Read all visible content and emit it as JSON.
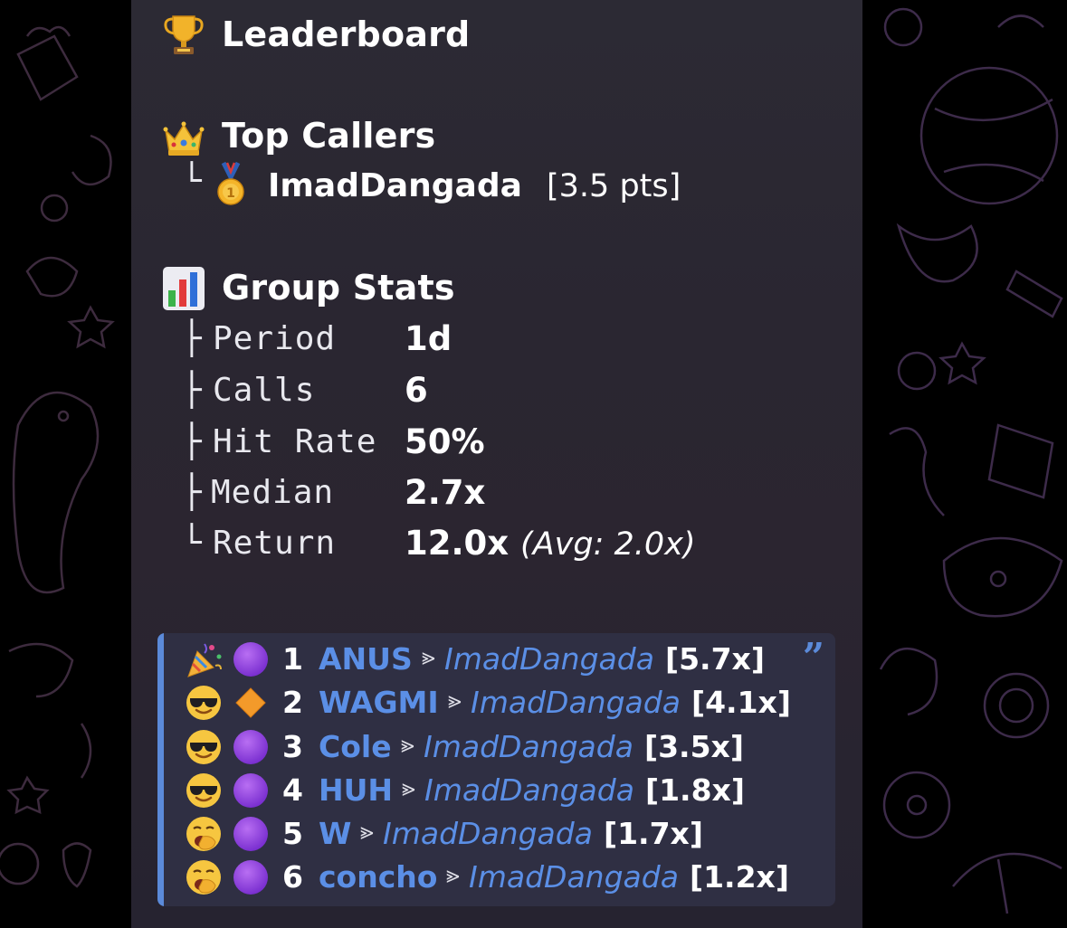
{
  "header": {
    "title": "Leaderboard",
    "title_icon": "trophy-icon"
  },
  "top_callers": {
    "heading": "Top Callers",
    "heading_icon": "crown-icon",
    "branch": "└",
    "entries": [
      {
        "medal_icon": "gold-medal-icon",
        "name": "ImadDangada",
        "points": "[3.5 pts]"
      }
    ]
  },
  "group_stats": {
    "heading": "Group Stats",
    "heading_icon": "bar-chart-icon",
    "rows": [
      {
        "branch": "├",
        "label": "Period",
        "value": "1d"
      },
      {
        "branch": "├",
        "label": "Calls",
        "value": "6"
      },
      {
        "branch": "├",
        "label": "Hit Rate",
        "value": "50%"
      },
      {
        "branch": "├",
        "label": "Median",
        "value": "2.7x"
      },
      {
        "branch": "└",
        "label": "Return",
        "value": "12.0x",
        "note": "(Avg: 2.0x)"
      }
    ]
  },
  "calls": {
    "quote_icon": "quote-icon",
    "separator": "⪢",
    "rows": [
      {
        "icon1": "party-popper-icon",
        "icon2": "purple-circle-icon",
        "rank": "1",
        "ticker": "ANUS",
        "caller": "ImadDangada",
        "multiple": "[5.7x]"
      },
      {
        "icon1": "sunglasses-face-icon",
        "icon2": "orange-diamond-icon",
        "rank": "2",
        "ticker": "WAGMI",
        "caller": "ImadDangada",
        "multiple": "[4.1x]"
      },
      {
        "icon1": "sunglasses-face-icon",
        "icon2": "purple-circle-icon",
        "rank": "3",
        "ticker": "Cole",
        "caller": "ImadDangada",
        "multiple": "[3.5x]"
      },
      {
        "icon1": "sunglasses-face-icon",
        "icon2": "purple-circle-icon",
        "rank": "4",
        "ticker": "HUH",
        "caller": "ImadDangada",
        "multiple": "[1.8x]"
      },
      {
        "icon1": "yawning-face-icon",
        "icon2": "purple-circle-icon",
        "rank": "5",
        "ticker": "W",
        "caller": "ImadDangada",
        "multiple": "[1.7x]"
      },
      {
        "icon1": "yawning-face-icon",
        "icon2": "purple-circle-icon",
        "rank": "6",
        "ticker": "concho",
        "caller": "ImadDangada",
        "multiple": "[1.2x]"
      }
    ]
  },
  "colors": {
    "bubble_bg": "#2c2a34",
    "quote_bg": "#2f2f43",
    "accent_blue": "#5b8fe6",
    "wallpaper_stroke": "#3a2a40"
  }
}
